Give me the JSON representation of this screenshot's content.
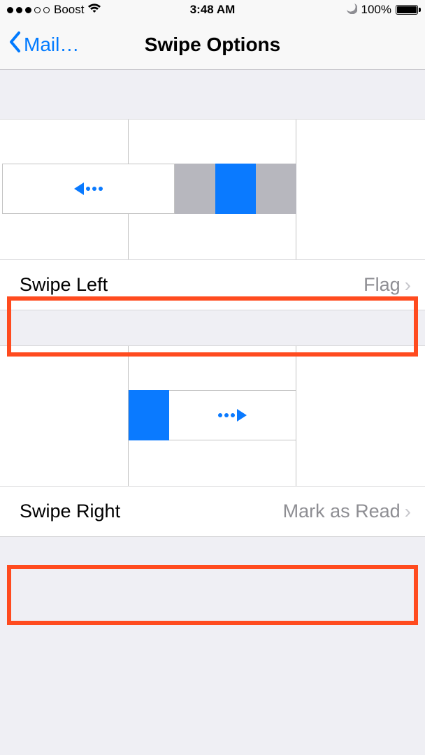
{
  "status_bar": {
    "carrier": "Boost",
    "time": "3:48 AM",
    "battery_pct": "100%",
    "signal_filled": 3,
    "signal_total": 5
  },
  "nav": {
    "back_label": "Mail…",
    "title": "Swipe Options"
  },
  "rows": {
    "swipe_left": {
      "label": "Swipe Left",
      "value": "Flag"
    },
    "swipe_right": {
      "label": "Swipe Right",
      "value": "Mark as Read"
    }
  }
}
